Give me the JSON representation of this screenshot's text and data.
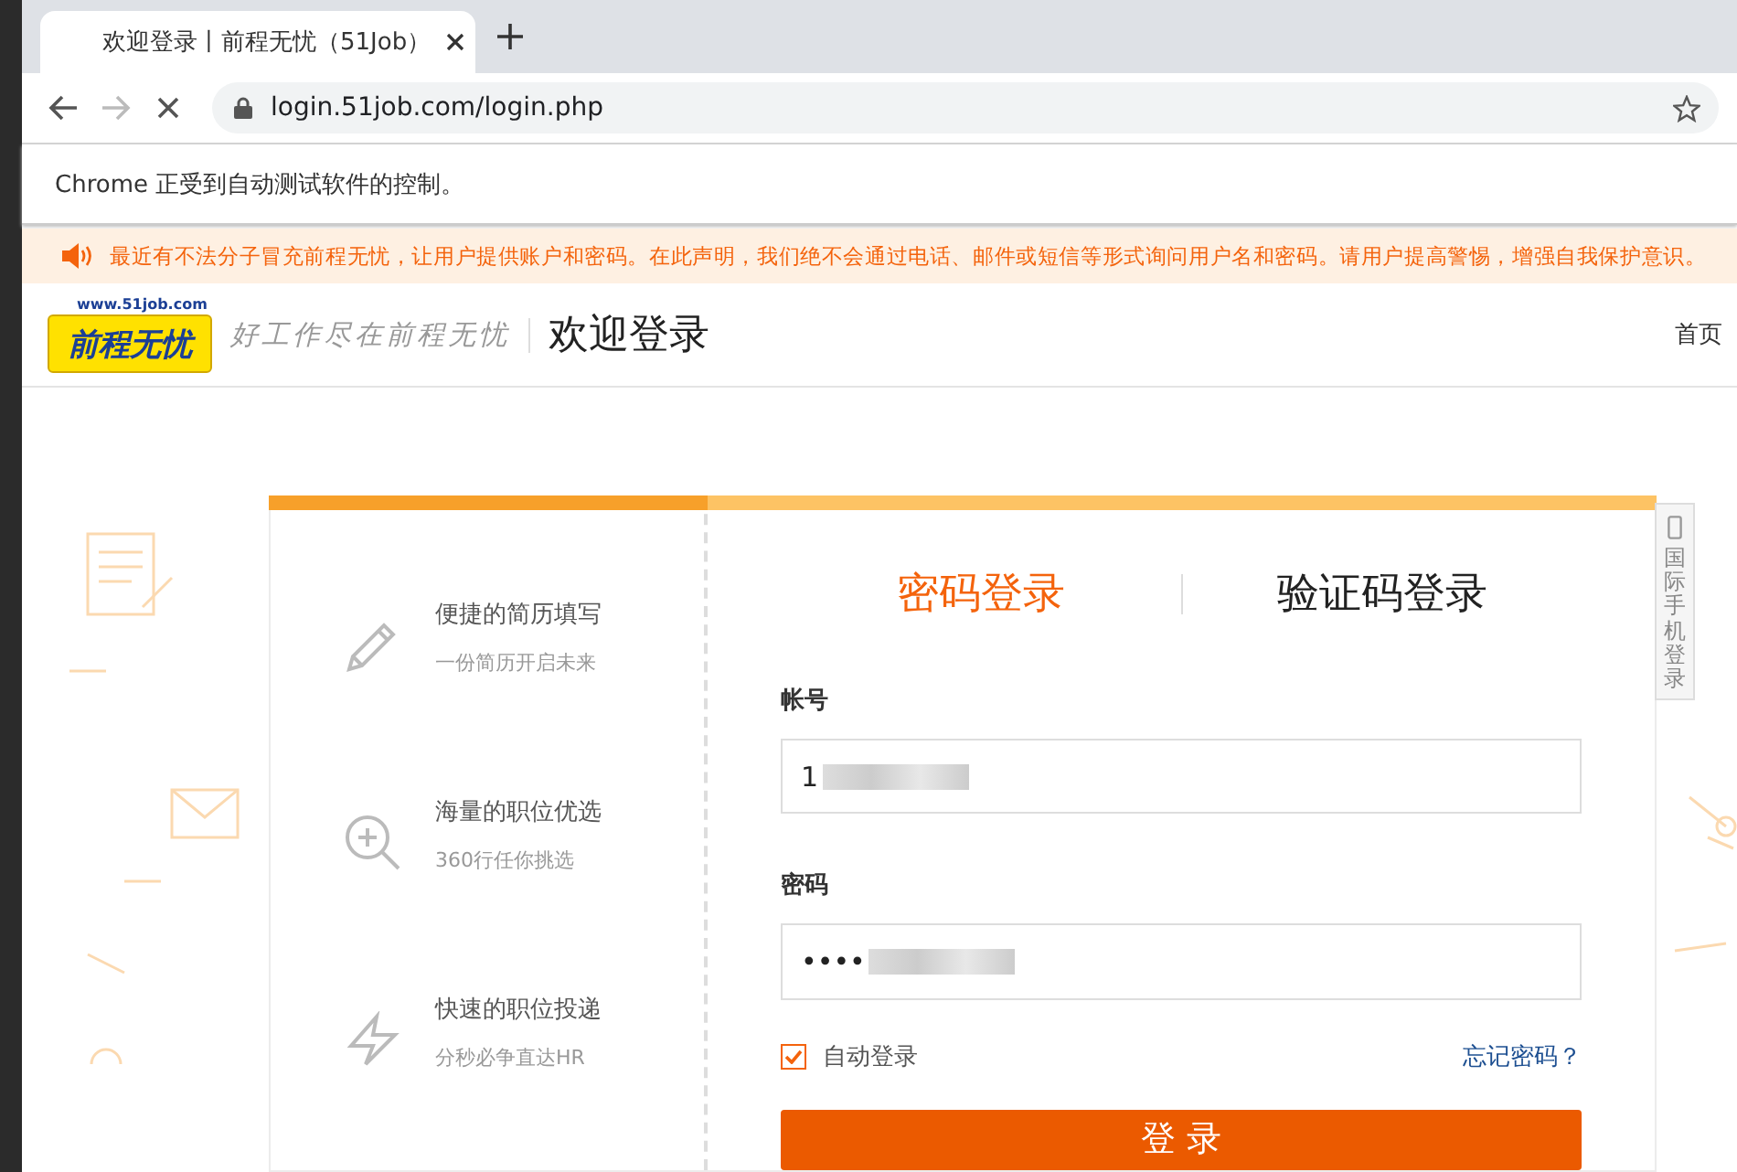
{
  "browser": {
    "tab_title": "欢迎登录丨前程无忧（51Job）",
    "url": "login.51job.com/login.php",
    "infobar": "Chrome 正受到自动测试软件的控制。"
  },
  "notice": "最近有不法分子冒充前程无忧，让用户提供账户和密码。在此声明，我们绝不会通过电话、邮件或短信等形式询问用户名和密码。请用户提高警惕，增强自我保护意识。",
  "header": {
    "logo_url": "www.51job.com",
    "logo_name": "前程无忧",
    "slogan": "好工作尽在前程无忧",
    "title": "欢迎登录",
    "nav": "首页"
  },
  "features": [
    {
      "kind": "pencil",
      "title": "便捷的简历填写",
      "subtitle": "一份简历开启未来"
    },
    {
      "kind": "zoom",
      "title": "海量的职位优选",
      "subtitle": "360行任你挑选"
    },
    {
      "kind": "bolt",
      "title": "快速的职位投递",
      "subtitle": "分秒必争直达HR"
    }
  ],
  "login_tabs": [
    {
      "label": "密码登录",
      "selected": true
    },
    {
      "label": "验证码登录",
      "selected": false
    }
  ],
  "account": {
    "label": "帐号",
    "value": "1"
  },
  "password": {
    "label": "密码",
    "value": "••••"
  },
  "remember": {
    "label": "自动登录",
    "checked": true
  },
  "forgot": "忘记密码？",
  "submit": "登 录",
  "side_tab": "国际手机登录"
}
